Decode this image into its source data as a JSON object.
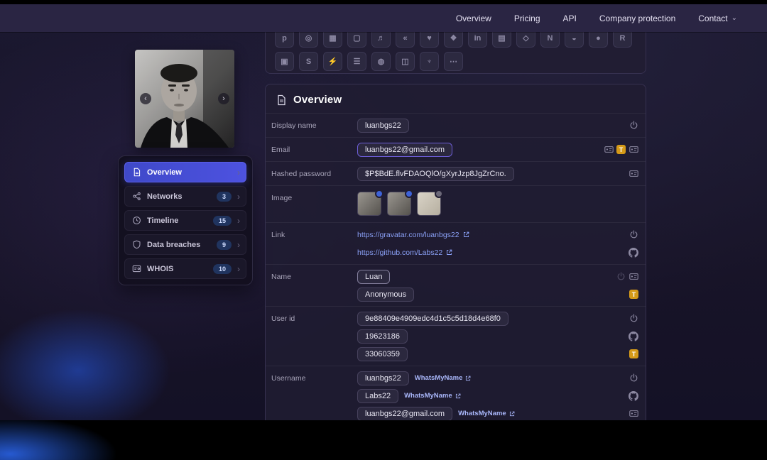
{
  "navbar": {
    "links": [
      "Overview",
      "Pricing",
      "API",
      "Company protection",
      "Contact"
    ]
  },
  "icons": {
    "chevron_down": "⌄",
    "chevron_right": "›",
    "carousel_prev": "‹",
    "carousel_next": "›",
    "t_badge": "T"
  },
  "sidebar": {
    "items": [
      {
        "label": "Overview",
        "badge": ""
      },
      {
        "label": "Networks",
        "badge": "3"
      },
      {
        "label": "Timeline",
        "badge": "15"
      },
      {
        "label": "Data breaches",
        "badge": "9"
      },
      {
        "label": "WHOIS",
        "badge": "10"
      }
    ]
  },
  "socials": {
    "row1": [
      "p",
      "◎",
      "▦",
      "▢",
      "♬",
      "«",
      "♥",
      "❖",
      "in",
      "▤",
      "◇",
      "N",
      "◒",
      "●",
      "R"
    ],
    "row2": [
      "▣",
      "S",
      "⚡",
      "☰",
      "◍",
      "◫",
      "♆",
      "⋯"
    ]
  },
  "overview": {
    "title": "Overview",
    "display_name": {
      "label": "Display name",
      "value": "luanbgs22"
    },
    "email": {
      "label": "Email",
      "value": "luanbgs22@gmail.com"
    },
    "hashed_password": {
      "label": "Hashed password",
      "value": "$P$BdE.flvFDAOQlO/gXyrJzp8JgZrCno."
    },
    "image": {
      "label": "Image"
    },
    "link": {
      "label": "Link",
      "links": [
        "https://gravatar.com/luanbgs22",
        "https://github.com/Labs22"
      ]
    },
    "name": {
      "label": "Name",
      "values": [
        "Luan",
        "Anonymous"
      ]
    },
    "user_id": {
      "label": "User id",
      "values": [
        "9e88409e4909edc4d1c5c5d18d4e68f0",
        "19623186",
        "33060359"
      ]
    },
    "username": {
      "label": "Username",
      "values": [
        {
          "text": "luanbgs22",
          "source": "WhatsMyName"
        },
        {
          "text": "Labs22",
          "source": "WhatsMyName"
        },
        {
          "text": "luanbgs22@gmail.com",
          "source": "WhatsMyName"
        }
      ]
    }
  }
}
